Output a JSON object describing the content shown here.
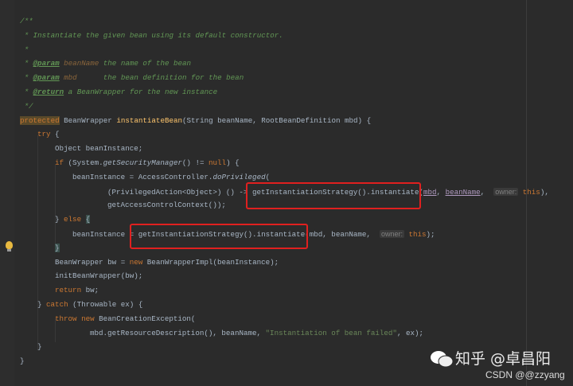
{
  "editor": {
    "lines": [
      {
        "indent": 0,
        "tokens": [
          {
            "t": "/**",
            "c": "cm"
          }
        ]
      },
      {
        "indent": 0,
        "tokens": [
          {
            "t": " * Instantiate the given bean using its default constructor.",
            "c": "cm"
          }
        ]
      },
      {
        "indent": 0,
        "tokens": [
          {
            "t": " *",
            "c": "cm"
          }
        ]
      },
      {
        "indent": 0,
        "tokens": [
          {
            "t": " * ",
            "c": "cm"
          },
          {
            "t": "@param",
            "c": "tag"
          },
          {
            "t": " beanName",
            "c": "pn"
          },
          {
            "t": " the name of the bean",
            "c": "cm"
          }
        ]
      },
      {
        "indent": 0,
        "tokens": [
          {
            "t": " * ",
            "c": "cm"
          },
          {
            "t": "@param",
            "c": "tag"
          },
          {
            "t": " mbd",
            "c": "pn"
          },
          {
            "t": "      the bean definition for the bean",
            "c": "cm"
          }
        ]
      },
      {
        "indent": 0,
        "tokens": [
          {
            "t": " * ",
            "c": "cm"
          },
          {
            "t": "@return",
            "c": "tag"
          },
          {
            "t": " a BeanWrapper for the new instance",
            "c": "cm"
          }
        ]
      },
      {
        "indent": 0,
        "tokens": [
          {
            "t": " */",
            "c": "cm"
          }
        ]
      },
      {
        "indent": 0,
        "tokens": [
          {
            "t": "protected",
            "c": "kwb"
          },
          {
            "t": " BeanWrapper ",
            "c": ""
          },
          {
            "t": "instantiateBean",
            "c": "fn"
          },
          {
            "t": "(String beanName, RootBeanDefinition mbd) {",
            "c": ""
          }
        ]
      },
      {
        "indent": 4,
        "tokens": [
          {
            "t": "try",
            "c": "kw"
          },
          {
            "t": " {",
            "c": ""
          }
        ]
      },
      {
        "indent": 8,
        "tokens": [
          {
            "t": "Object beanInstance;",
            "c": ""
          }
        ]
      },
      {
        "indent": 8,
        "tokens": [
          {
            "t": "if",
            "c": "kw"
          },
          {
            "t": " (System.",
            "c": ""
          },
          {
            "t": "getSecurityManager",
            "c": "it"
          },
          {
            "t": "() != ",
            "c": ""
          },
          {
            "t": "null",
            "c": "kw"
          },
          {
            "t": ") {",
            "c": ""
          }
        ]
      },
      {
        "indent": 12,
        "tokens": [
          {
            "t": "beanInstance = AccessController.",
            "c": ""
          },
          {
            "t": "doPrivileged",
            "c": "it"
          },
          {
            "t": "(",
            "c": ""
          }
        ]
      },
      {
        "indent": 20,
        "tokens": [
          {
            "t": "(PrivilegedAction<Object>) () -> ",
            "c": ""
          },
          {
            "t": "getInstantiationStrategy().instantiate",
            "c": ""
          },
          {
            "t": "(",
            "c": ""
          },
          {
            "t": "mbd",
            "c": "ul"
          },
          {
            "t": ", ",
            "c": ""
          },
          {
            "t": "beanName",
            "c": "ul"
          },
          {
            "t": ",  ",
            "c": ""
          },
          {
            "t": "owner:",
            "c": "hint"
          },
          {
            "t": " ",
            "c": ""
          },
          {
            "t": "this",
            "c": "kw"
          },
          {
            "t": "),",
            "c": ""
          }
        ]
      },
      {
        "indent": 20,
        "tokens": [
          {
            "t": "getAccessControlContext());",
            "c": ""
          }
        ]
      },
      {
        "indent": 8,
        "tokens": [
          {
            "t": "} ",
            "c": ""
          },
          {
            "t": "else",
            "c": "kw"
          },
          {
            "t": " ",
            "c": ""
          },
          {
            "t": "{",
            "c": "brk"
          }
        ]
      },
      {
        "indent": 12,
        "tokens": [
          {
            "t": "beanInstance = ",
            "c": ""
          },
          {
            "t": "getInstantiationStrategy().instantiate",
            "c": ""
          },
          {
            "t": "(mbd, beanName,  ",
            "c": ""
          },
          {
            "t": "owner:",
            "c": "hint"
          },
          {
            "t": " ",
            "c": ""
          },
          {
            "t": "this",
            "c": "kw"
          },
          {
            "t": ");",
            "c": ""
          }
        ]
      },
      {
        "indent": 8,
        "tokens": [
          {
            "t": "}",
            "c": "brk"
          }
        ]
      },
      {
        "indent": 8,
        "tokens": [
          {
            "t": "BeanWrapper bw = ",
            "c": ""
          },
          {
            "t": "new",
            "c": "kw"
          },
          {
            "t": " BeanWrapperImpl(beanInstance);",
            "c": ""
          }
        ]
      },
      {
        "indent": 8,
        "tokens": [
          {
            "t": "initBeanWrapper(bw);",
            "c": ""
          }
        ]
      },
      {
        "indent": 8,
        "tokens": [
          {
            "t": "return",
            "c": "kw"
          },
          {
            "t": " bw;",
            "c": ""
          }
        ]
      },
      {
        "indent": 4,
        "tokens": [
          {
            "t": "} ",
            "c": ""
          },
          {
            "t": "catch",
            "c": "kw"
          },
          {
            "t": " (Throwable ex) {",
            "c": ""
          }
        ]
      },
      {
        "indent": 8,
        "tokens": [
          {
            "t": "throw new",
            "c": "kw"
          },
          {
            "t": " BeanCreationException(",
            "c": ""
          }
        ]
      },
      {
        "indent": 16,
        "tokens": [
          {
            "t": "mbd.getResourceDescription(), beanName, ",
            "c": ""
          },
          {
            "t": "\"Instantiation of bean failed\"",
            "c": "str"
          },
          {
            "t": ", ex);",
            "c": ""
          }
        ]
      },
      {
        "indent": 4,
        "tokens": [
          {
            "t": "}",
            "c": ""
          }
        ]
      },
      {
        "indent": 0,
        "tokens": [
          {
            "t": "}",
            "c": ""
          }
        ]
      }
    ]
  },
  "watermark": {
    "zhihu": "知乎 @卓昌阳",
    "csdn": "CSDN @@zzyang"
  },
  "colors": {
    "background": "#2b2b2b",
    "highlight_box": "#e0201f",
    "keyword": "#cc7832",
    "method": "#ffc66d",
    "comment": "#629755",
    "string": "#6a8759"
  }
}
